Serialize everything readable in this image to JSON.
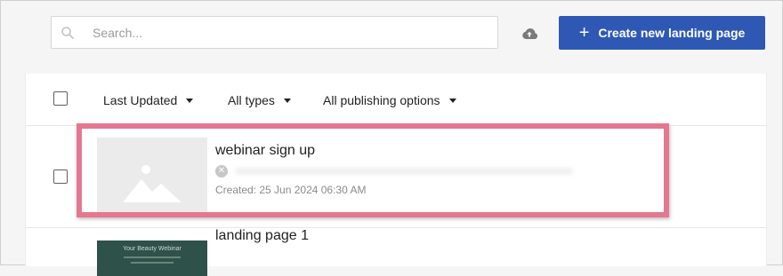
{
  "search": {
    "placeholder": "Search...",
    "value": ""
  },
  "toolbar": {
    "create_label": "Create new landing page",
    "upload_icon": "cloud-upload-icon"
  },
  "filters": [
    {
      "label": "Last Updated"
    },
    {
      "label": "All types"
    },
    {
      "label": "All publishing options"
    }
  ],
  "pages": [
    {
      "title": "webinar sign up",
      "url": "",
      "created": "Created: 25 Jun 2024 06:30 AM",
      "thumbnail": "image-placeholder-icon"
    },
    {
      "title": "landing page 1",
      "thumbnail_text": "Your Beauty Webinar"
    }
  ],
  "colors": {
    "accent": "#2f58b4",
    "highlight": "#e67791",
    "background": "#f5f5f5"
  }
}
